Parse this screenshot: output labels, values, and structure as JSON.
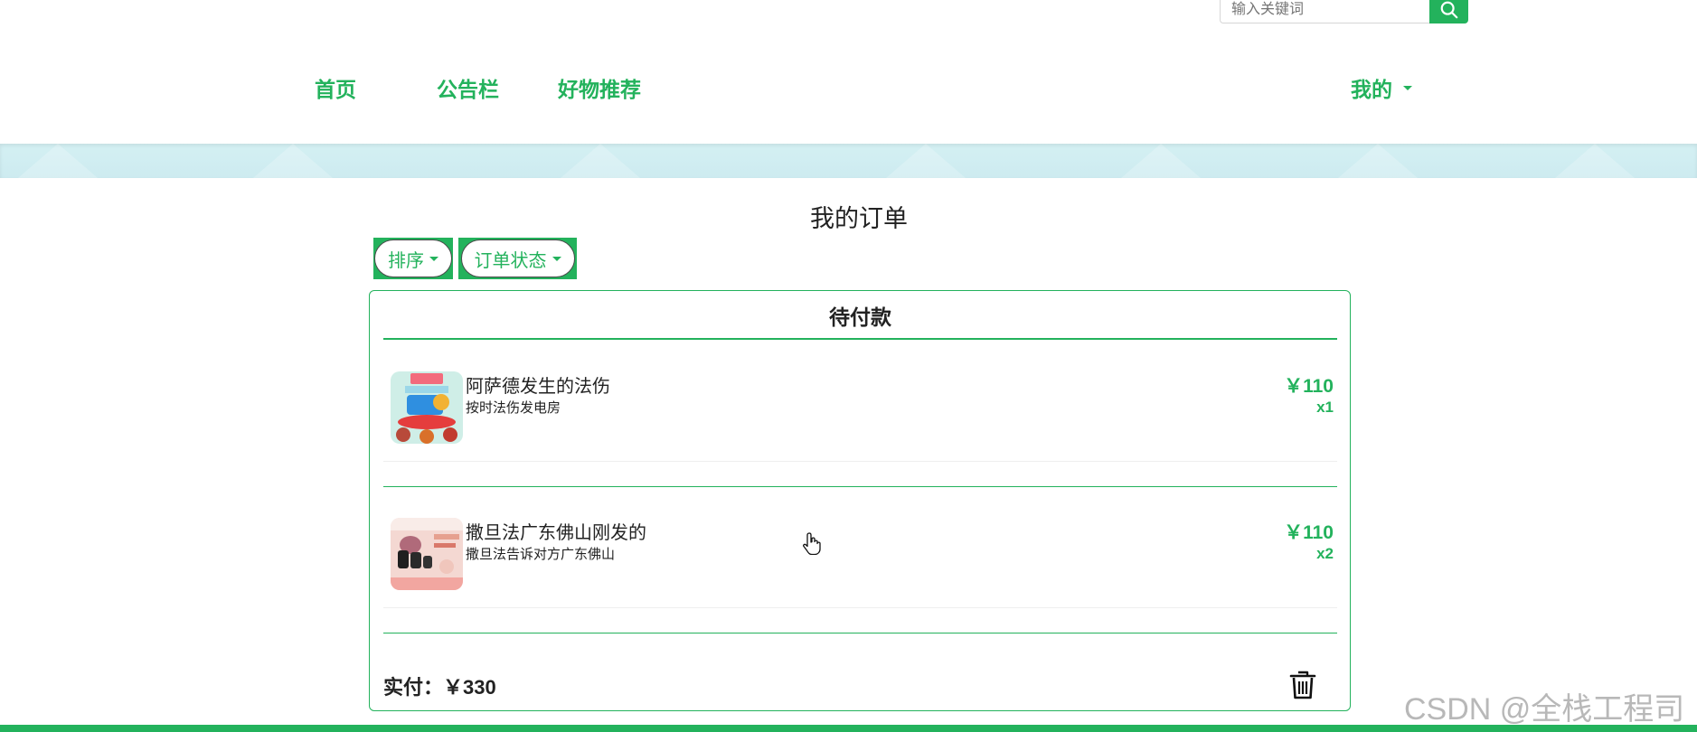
{
  "search": {
    "placeholder": "输入关键词",
    "icon": "search-icon"
  },
  "nav": {
    "items": [
      {
        "label": "首页"
      },
      {
        "label": "公告栏"
      },
      {
        "label": "好物推荐"
      }
    ],
    "mine_label": "我的"
  },
  "page": {
    "title": "我的订单",
    "filters": {
      "sort_label": "排序",
      "status_label": "订单状态"
    }
  },
  "order": {
    "status": "待付款",
    "items": [
      {
        "name": "阿萨德发生的法伤",
        "desc": "按时法伤发电房",
        "price": "￥110",
        "qty": "x1"
      },
      {
        "name": "撒旦法广东佛山刚发的",
        "desc": "撒旦法告诉对方广东佛山",
        "price": "￥110",
        "qty": "x2"
      }
    ],
    "total_label": "实付：",
    "total_value": "￥330"
  },
  "watermark": "CSDN @全栈工程司",
  "colors": {
    "accent": "#23b25c",
    "banner": "#d4f0f3"
  }
}
